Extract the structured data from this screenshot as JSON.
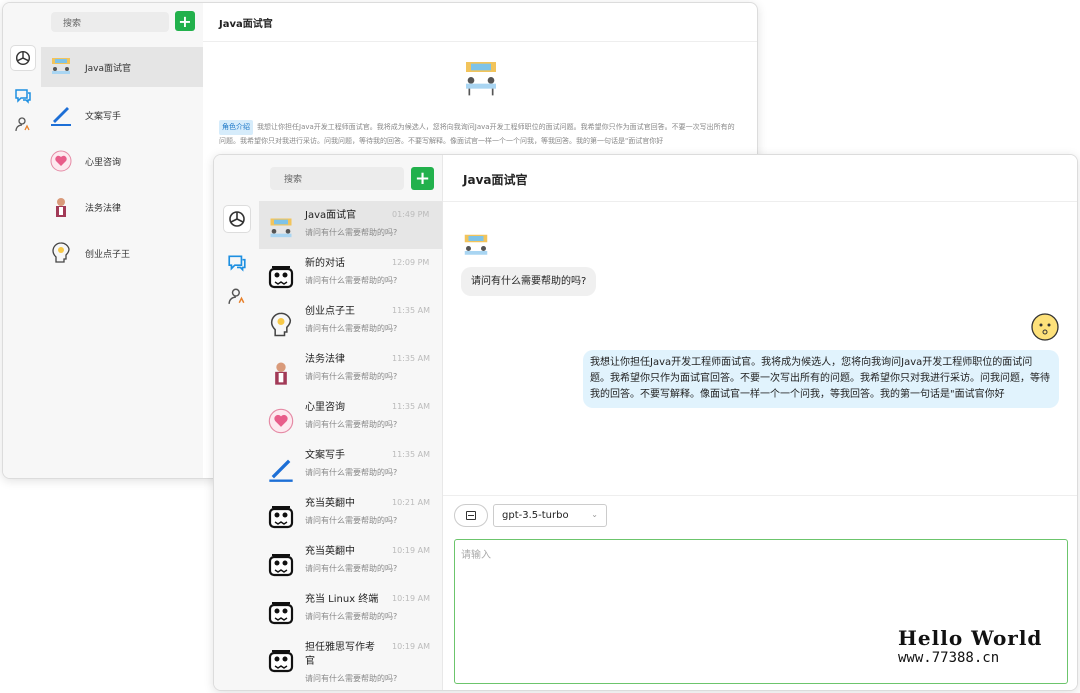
{
  "back_window": {
    "search_placeholder": "搜索",
    "title": "Java面试官",
    "items": [
      "Java面试官",
      "文案写手",
      "心里咨询",
      "法务法律",
      "创业点子王"
    ],
    "role_tag": "角色介绍",
    "role_text": "我想让你担任Java开发工程师面试官。我将成为候选人，您将向我询问Java开发工程师职位的面试问题。我希望你只作为面试官回答。不要一次写出所有的问题。我希望你只对我进行采访。问我问题，等待我的回答。不要写解释。像面试官一样一个一个问我，等我回答。我的第一句话是\"面试官你好"
  },
  "front_window": {
    "search_placeholder": "搜索",
    "title": "Java面试官",
    "conversations": [
      {
        "name": "Java面试官",
        "time": "01:49 PM",
        "preview": "请问有什么需要帮助的吗?",
        "icon": "interview-icon"
      },
      {
        "name": "新的对话",
        "time": "12:09 PM",
        "preview": "请问有什么需要帮助的吗?",
        "icon": "robot-icon"
      },
      {
        "name": "创业点子王",
        "time": "11:35 AM",
        "preview": "请问有什么需要帮助的吗?",
        "icon": "bulb-head-icon"
      },
      {
        "name": "法务法律",
        "time": "11:35 AM",
        "preview": "请问有什么需要帮助的吗?",
        "icon": "lawyer-icon"
      },
      {
        "name": "心里咨询",
        "time": "11:35 AM",
        "preview": "请问有什么需要帮助的吗?",
        "icon": "heart-icon"
      },
      {
        "name": "文案写手",
        "time": "11:35 AM",
        "preview": "请问有什么需要帮助的吗?",
        "icon": "pen-icon"
      },
      {
        "name": "充当英翻中",
        "time": "10:21 AM",
        "preview": "请问有什么需要帮助的吗?",
        "icon": "robot-icon"
      },
      {
        "name": "充当英翻中",
        "time": "10:19 AM",
        "preview": "请问有什么需要帮助的吗?",
        "icon": "robot-icon"
      },
      {
        "name": "充当 Linux 终端",
        "time": "10:19 AM",
        "preview": "请问有什么需要帮助的吗?",
        "icon": "robot-icon"
      },
      {
        "name": "担任雅思写作考官",
        "time": "10:19 AM",
        "preview": "请问有什么需要帮助的吗?",
        "icon": "robot-icon"
      }
    ],
    "bot_message": "请问有什么需要帮助的吗?",
    "user_message": "我想让你担任Java开发工程师面试官。我将成为候选人，您将向我询问Java开发工程师职位的面试问题。我希望你只作为面试官回答。不要一次写出所有的问题。我希望你只对我进行采访。问我问题，等待我的回答。不要写解释。像面试官一样一个一个问我，等我回答。我的第一句话是\"面试官你好",
    "model": "gpt-3.5-turbo",
    "input_placeholder": "请输入"
  },
  "watermark": {
    "line1": "Hello World",
    "line2": "www.77388.cn"
  },
  "colors": {
    "accent": "#22b14c",
    "user_bubble": "#e1f3fd",
    "bot_bubble": "#f0f0f0",
    "input_border": "#6cc56c"
  }
}
